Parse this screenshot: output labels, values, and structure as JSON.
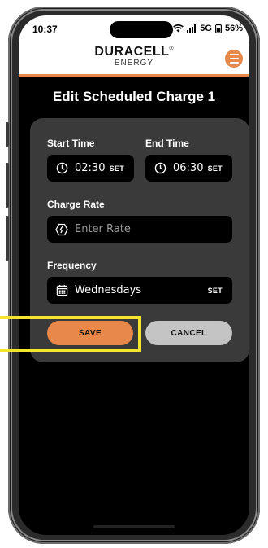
{
  "status_bar": {
    "time": "10:37",
    "network": "5G",
    "battery": "56%"
  },
  "header": {
    "logo_main": "DURACELL",
    "logo_registered": "®",
    "logo_sub": "ENERGY",
    "menu_icon": "hamburger-icon"
  },
  "title": "Edit Scheduled Charge 1",
  "form": {
    "start_time": {
      "label": "Start Time",
      "value": "02:30",
      "action": "SET",
      "icon": "clock-icon"
    },
    "end_time": {
      "label": "End Time",
      "value": "06:30",
      "action": "SET",
      "icon": "clock-icon"
    },
    "charge_rate": {
      "label": "Charge Rate",
      "placeholder": "Enter Rate",
      "icon": "lightning-icon"
    },
    "frequency": {
      "label": "Frequency",
      "value": "Wednesdays",
      "action": "SET",
      "icon": "calendar-icon"
    }
  },
  "buttons": {
    "save": "SAVE",
    "cancel": "CANCEL"
  },
  "colors": {
    "accent": "#e8884a",
    "card": "#3a3a3a",
    "highlight": "#f3e52b"
  }
}
